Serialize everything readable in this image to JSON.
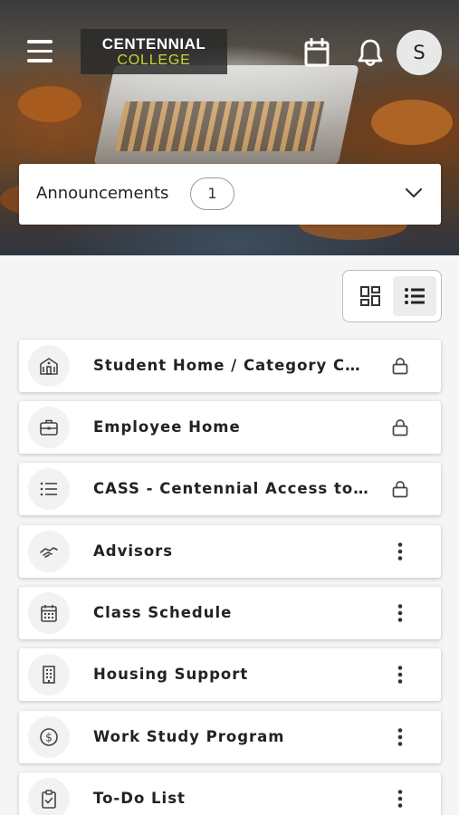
{
  "header": {
    "logo_line1": "CENTENNIAL",
    "logo_line2": "COLLEGE",
    "avatar_initial": "S",
    "icons": [
      "menu-icon",
      "calendar-icon",
      "bell-icon"
    ]
  },
  "announcements": {
    "label": "Announcements",
    "count": "1"
  },
  "view_toggle": {
    "options": [
      "grid-view",
      "list-view"
    ],
    "selected": "list-view"
  },
  "cards": [
    {
      "title": "Student Home / Category Card",
      "icon": "school-icon",
      "action": "lock"
    },
    {
      "title": "Employee Home",
      "icon": "briefcase-icon",
      "action": "lock"
    },
    {
      "title": "CASS - Centennial Access to Student Services",
      "icon": "list-icon",
      "action": "lock"
    },
    {
      "title": "Advisors",
      "icon": "handshake-icon",
      "action": "more"
    },
    {
      "title": "Class Schedule",
      "icon": "calendar-icon",
      "action": "more"
    },
    {
      "title": "Housing Support",
      "icon": "building-icon",
      "action": "more"
    },
    {
      "title": "Work Study Program",
      "icon": "dollar-icon",
      "action": "more"
    },
    {
      "title": "To-Do List",
      "icon": "clipboard-icon",
      "action": "more"
    }
  ],
  "colors": {
    "logo_accent": "#c5d82e",
    "background": "#f5f5f5",
    "text": "#222222"
  }
}
